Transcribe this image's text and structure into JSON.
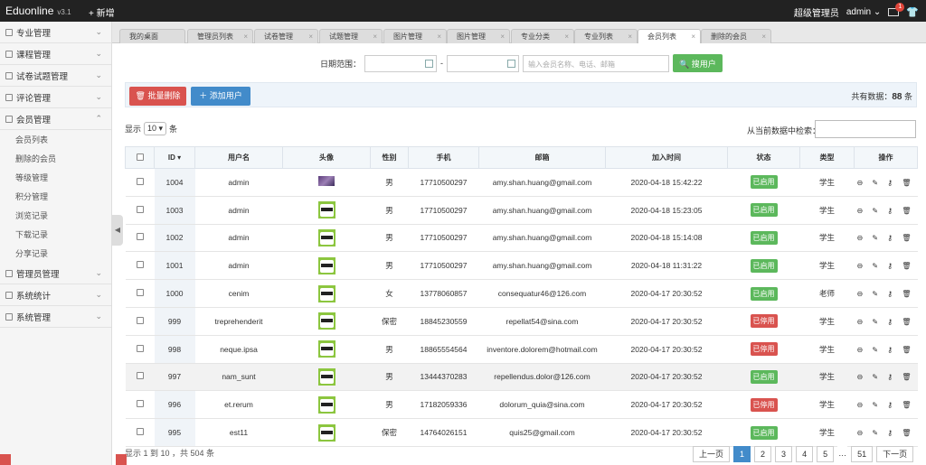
{
  "app": {
    "name": "Eduonline",
    "version": "v3.1",
    "new_label": "+ 新增",
    "role": "超级管理员",
    "user": "admin",
    "mail_count": "1"
  },
  "sidebar": {
    "menus": [
      {
        "label": "专业管理",
        "chev": "⌄"
      },
      {
        "label": "课程管理",
        "chev": "⌄"
      },
      {
        "label": "试卷试题管理",
        "chev": "⌄"
      },
      {
        "label": "评论管理",
        "chev": "⌄"
      },
      {
        "label": "会员管理",
        "chev": "⌃"
      }
    ],
    "sub_items": [
      "会员列表",
      "删除的会员",
      "等级管理",
      "积分管理",
      "浏览记录",
      "下载记录",
      "分享记录"
    ],
    "menus_after": [
      {
        "label": "管理员管理",
        "chev": "⌄"
      },
      {
        "label": "系统统计",
        "chev": "⌄"
      },
      {
        "label": "系统管理",
        "chev": "⌄"
      }
    ]
  },
  "tabs": [
    "我的桌面",
    "管理员列表",
    "试卷管理",
    "试题管理",
    "图片管理",
    "图片管理",
    "专业分类",
    "专业列表",
    "会员列表",
    "删除的会员"
  ],
  "filter": {
    "date_label": "日期范围：",
    "dash": "-",
    "keyword_placeholder": "输入会员名称、电话、邮箱",
    "search_button": "搜用户"
  },
  "actions": {
    "batch_delete": "批量删除",
    "add_user": "添加用户",
    "total_prefix": "共有数据：",
    "total_count": "88",
    "total_suffix": "条"
  },
  "table_controls": {
    "show_prefix": "显示",
    "page_size": "10 ▾",
    "show_suffix": "条",
    "search_label": "从当前数据中检索："
  },
  "table": {
    "headers": [
      "ID ▾",
      "用户名",
      "头像",
      "性别",
      "手机",
      "邮箱",
      "加入时间",
      "状态",
      "类型",
      "操作"
    ],
    "rows": [
      {
        "id": "1004",
        "username": "admin",
        "avatar": "photo",
        "gender": "男",
        "phone": "17710500297",
        "email": "amy.shan.huang@gmail.com",
        "joined": "2020-04-18 15:42:22",
        "status": "已启用",
        "status_on": true,
        "type": "学生"
      },
      {
        "id": "1003",
        "username": "admin",
        "avatar": "ninja",
        "gender": "男",
        "phone": "17710500297",
        "email": "amy.shan.huang@gmail.com",
        "joined": "2020-04-18 15:23:05",
        "status": "已启用",
        "status_on": true,
        "type": "学生"
      },
      {
        "id": "1002",
        "username": "admin",
        "avatar": "ninja",
        "gender": "男",
        "phone": "17710500297",
        "email": "amy.shan.huang@gmail.com",
        "joined": "2020-04-18 15:14:08",
        "status": "已启用",
        "status_on": true,
        "type": "学生"
      },
      {
        "id": "1001",
        "username": "admin",
        "avatar": "ninja",
        "gender": "男",
        "phone": "17710500297",
        "email": "amy.shan.huang@gmail.com",
        "joined": "2020-04-18 11:31:22",
        "status": "已启用",
        "status_on": true,
        "type": "学生"
      },
      {
        "id": "1000",
        "username": "cenim",
        "avatar": "ninja",
        "gender": "女",
        "phone": "13778060857",
        "email": "consequatur46@126.com",
        "joined": "2020-04-17 20:30:52",
        "status": "已启用",
        "status_on": true,
        "type": "老师"
      },
      {
        "id": "999",
        "username": "treprehenderit",
        "avatar": "ninja",
        "gender": "保密",
        "phone": "18845230559",
        "email": "repellat54@sina.com",
        "joined": "2020-04-17 20:30:52",
        "status": "已停用",
        "status_on": false,
        "type": "学生"
      },
      {
        "id": "998",
        "username": "neque.ipsa",
        "avatar": "ninja",
        "gender": "男",
        "phone": "18865554564",
        "email": "inventore.dolorem@hotmail.com",
        "joined": "2020-04-17 20:30:52",
        "status": "已停用",
        "status_on": false,
        "type": "学生"
      },
      {
        "id": "997",
        "username": "nam_sunt",
        "avatar": "ninja",
        "gender": "男",
        "phone": "13444370283",
        "email": "repellendus.dolor@126.com",
        "joined": "2020-04-17 20:30:52",
        "status": "已启用",
        "status_on": true,
        "type": "学生"
      },
      {
        "id": "996",
        "username": "et.rerum",
        "avatar": "ninja",
        "gender": "男",
        "phone": "17182059336",
        "email": "dolorum_quia@sina.com",
        "joined": "2020-04-17 20:30:52",
        "status": "已停用",
        "status_on": false,
        "type": "学生"
      },
      {
        "id": "995",
        "username": "est11",
        "avatar": "ninja",
        "gender": "保密",
        "phone": "14764026151",
        "email": "quis25@gmail.com",
        "joined": "2020-04-17 20:30:52",
        "status": "已启用",
        "status_on": true,
        "type": "学生"
      }
    ],
    "row_ops": "⊖ ✎ ⚷ 🗑"
  },
  "pagination": {
    "info": "显示 1 到 10 ，共 504 条",
    "prev": "上一页",
    "pages": [
      "1",
      "2",
      "3",
      "4",
      "5",
      "…",
      "51"
    ],
    "active": "1",
    "next": "下一页"
  },
  "colors": {
    "topbar": "#222222",
    "primary": "#428bca",
    "success": "#5cb85c",
    "danger": "#d9534f"
  }
}
